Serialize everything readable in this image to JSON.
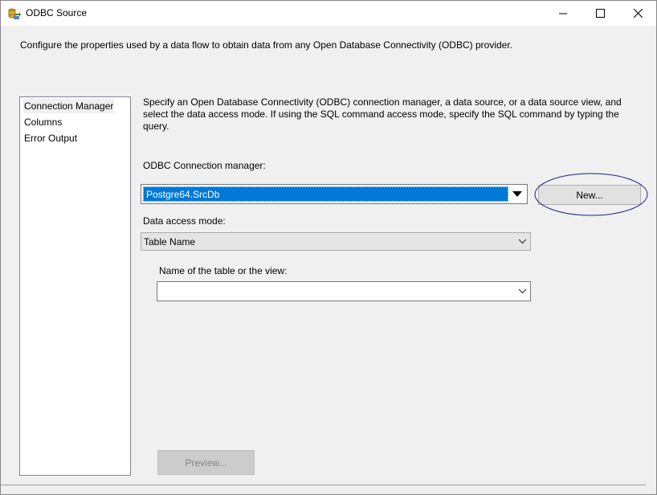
{
  "window": {
    "title": "ODBC Source",
    "icon": "ssis-odbc-source-icon"
  },
  "description": "Configure the properties used by a data flow to obtain data from any Open Database Connectivity (ODBC) provider.",
  "nav": {
    "items": [
      {
        "label": "Connection Manager",
        "selected": true
      },
      {
        "label": "Columns",
        "selected": false
      },
      {
        "label": "Error Output",
        "selected": false
      }
    ]
  },
  "main": {
    "intro": "Specify an Open Database Connectivity (ODBC) connection manager, a data source, or a data source view, and select the data access mode. If using the SQL command access mode, specify the SQL command by typing the query.",
    "connection_label": "ODBC Connection manager:",
    "connection_value": "Postgre64.SrcDb",
    "new_button": "New...",
    "access_mode_label": "Data access mode:",
    "access_mode_value": "Table Name",
    "table_label": "Name of the table or the view:",
    "table_value": "",
    "preview_button": "Preview..."
  },
  "colors": {
    "selection": "#0078d7",
    "annotation": "#1a237e"
  }
}
